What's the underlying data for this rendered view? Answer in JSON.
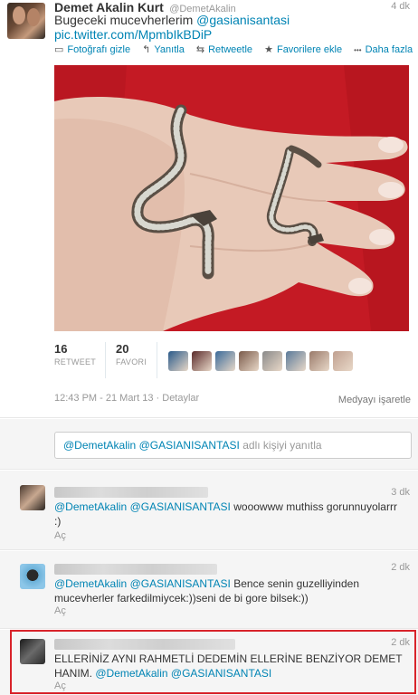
{
  "tweet": {
    "fullname": "Demet Akalin Kurt",
    "screenname": "@DemetAkalin",
    "time": "4 dk",
    "text_plain": "Bugeceki mucevherlerim ",
    "text_mention": "@gasianisantasi",
    "text_link": "pic.twitter.com/MpmbIkBDiP",
    "actions": [
      {
        "icon": "photo-icon",
        "glyph": "▭",
        "label": "Fotoğrafı gizle"
      },
      {
        "icon": "reply-icon",
        "glyph": "↰",
        "label": "Yanıtla"
      },
      {
        "icon": "retweet-icon",
        "glyph": "⇆",
        "label": "Retweetle"
      },
      {
        "icon": "star-icon",
        "glyph": "★",
        "label": "Favorilere ekle"
      },
      {
        "icon": "more-icon",
        "glyph": "•••",
        "label": "Daha fazla"
      }
    ],
    "stats": {
      "retweets": "16",
      "retweets_label": "RETWEET",
      "favorites": "20",
      "favorites_label": "FAVORI"
    },
    "favoriter_avatars": [
      "#2a5a8a",
      "#5a2a2a",
      "#3a6a9a",
      "#7a5a4a",
      "#8a8a8a",
      "#5a7a9a",
      "#9a7a6a",
      "#c0a090"
    ],
    "timestamp": "12:43 PM - 21 Mart 13",
    "dot": "·",
    "details_label": "Detaylar",
    "media_flag_label": "Medyayı işaretle"
  },
  "reply_box": {
    "mention1": "@DemetAkalin",
    "mention2": "@GASIANISANTASI",
    "placeholder": "adlı kişiyi yanıtla"
  },
  "replies": [
    {
      "time": "3 dk",
      "mention1": "@DemetAkalin",
      "mention2": "@GASIANISANTASI",
      "text": " wooowww muthiss gorunnuyolarrr :)",
      "open_label": "Aç"
    },
    {
      "time": "2 dk",
      "mention1": "@DemetAkalin",
      "mention2": "@GASIANISANTASI",
      "text": " Bence senin guzelliyinden mucevherler farkedilmiycek:))seni de bi gore bilsek:))",
      "open_label": "Aç"
    },
    {
      "time": "2 dk",
      "prefix": "ELLERİNİZ AYNI RAHMETLİ DEDEMİN ELLERİNE BENZİYOR DEMET HANIM. ",
      "mention1": "@DemetAkalin",
      "mention2": "@GASIANISANTASI",
      "open_label": "Aç"
    }
  ],
  "colors": {
    "link": "#0084b4",
    "highlight_border": "#d8232a",
    "photo_background": "#c41a24"
  }
}
